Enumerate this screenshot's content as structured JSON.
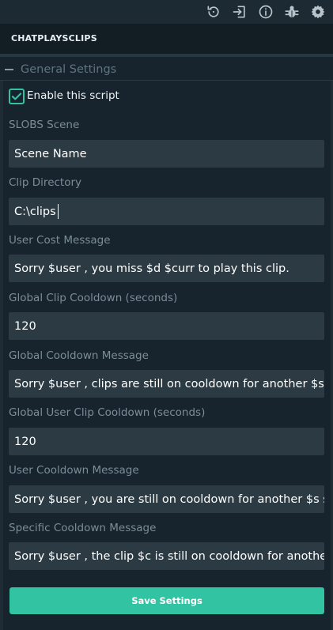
{
  "toolbar": {
    "icons": [
      "reload-icon",
      "import-icon",
      "info-icon",
      "bug-icon",
      "gear-icon"
    ]
  },
  "header": {
    "title": "CHATPLAYSCLIPS"
  },
  "section": {
    "title": "General Settings"
  },
  "enable": {
    "label": "Enable this script",
    "checked": true
  },
  "fields": [
    {
      "label": "SLOBS Scene",
      "value": "Scene Name"
    },
    {
      "label": "Clip Directory",
      "value": "C:\\clips"
    },
    {
      "label": "User Cost Message",
      "value": "Sorry $user , you miss $d $curr to play this clip."
    },
    {
      "label": "Global Clip Cooldown (seconds)",
      "value": "120"
    },
    {
      "label": "Global Cooldown Message",
      "value": "Sorry $user , clips are still on cooldown for another $s seconds."
    },
    {
      "label": "Global User Clip Cooldown (seconds)",
      "value": "120"
    },
    {
      "label": "User Cooldown Message",
      "value": "Sorry $user , you are still on cooldown for another $s seconds."
    },
    {
      "label": "Specific Cooldown Message",
      "value": "Sorry $user , the clip $c is still on cooldown for another $s seconds."
    }
  ],
  "save_button": {
    "label": "Save Settings"
  },
  "colors": {
    "accent": "#31c3a2",
    "background": "#17242d",
    "field_background": "#2c3b43",
    "label": "#7b8d97"
  }
}
